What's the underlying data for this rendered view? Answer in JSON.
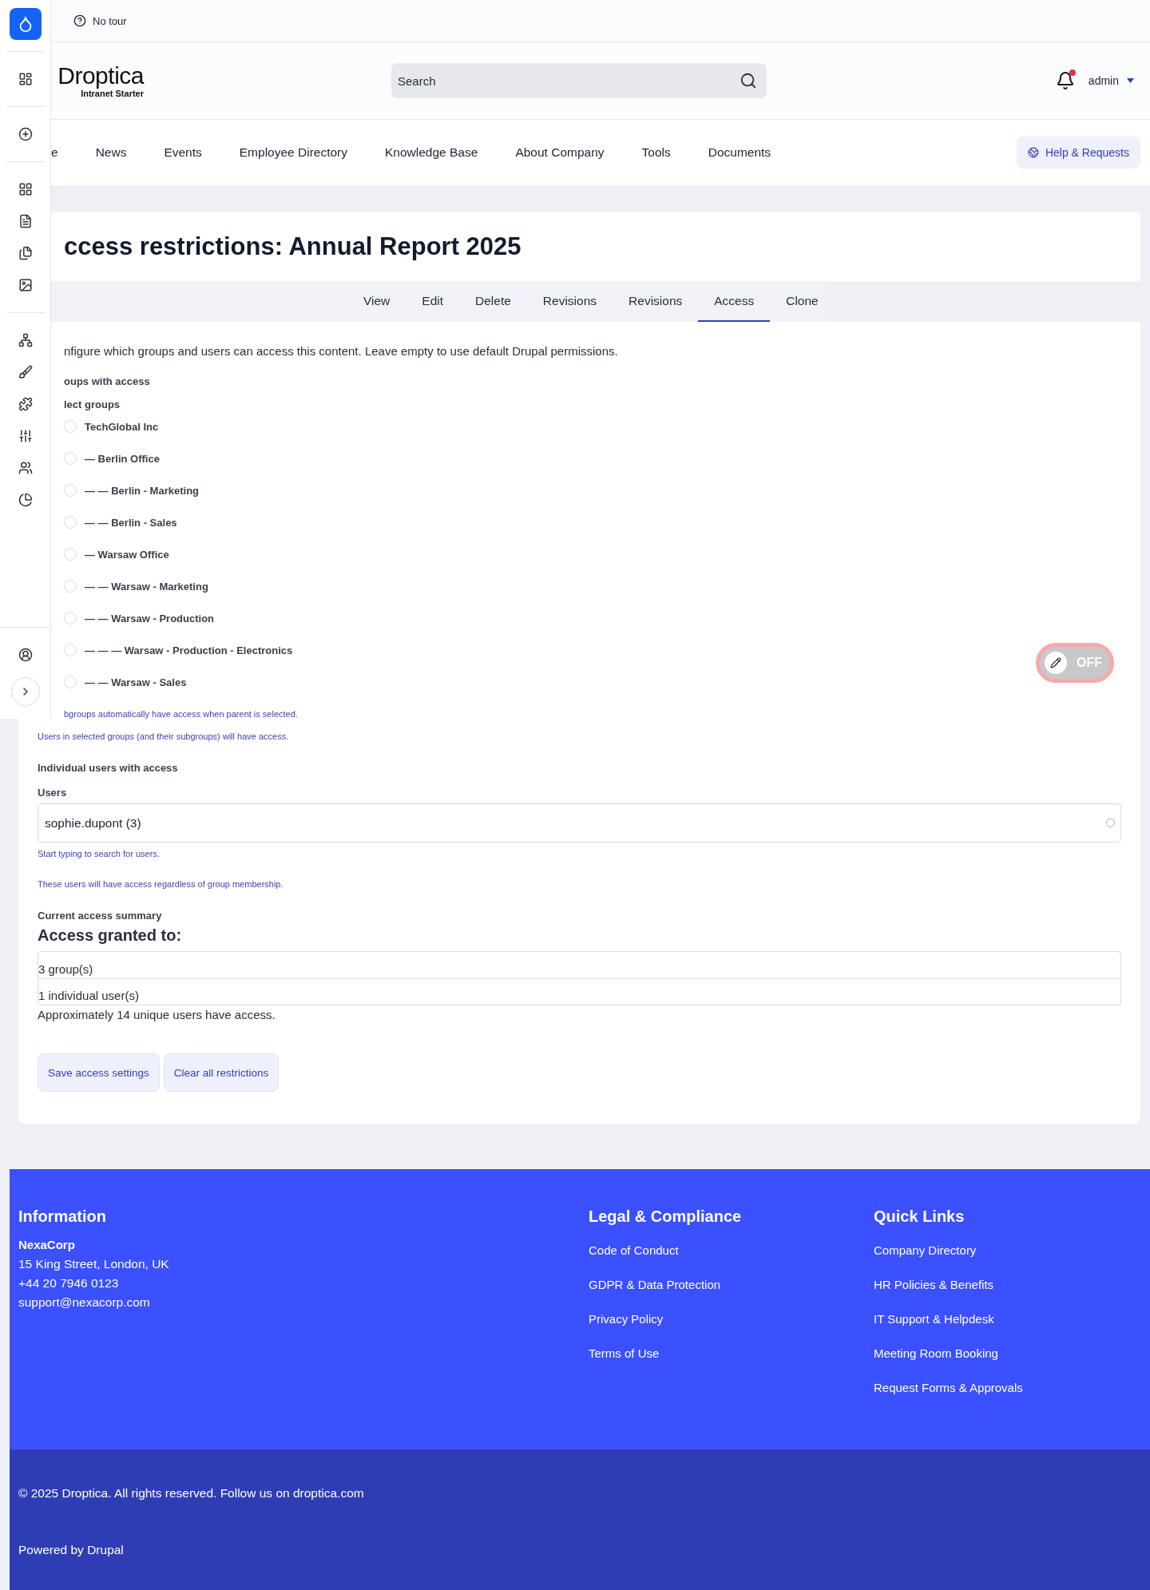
{
  "toolbar": {
    "tour": "No tour"
  },
  "header": {
    "logo": "Droptica",
    "logo_sub": "Intranet Starter",
    "search": {
      "placeholder": "Search"
    },
    "notifications": {
      "unread": true
    },
    "user": "admin"
  },
  "nav": {
    "items": [
      {
        "label": "e",
        "selected": false
      },
      {
        "label": "News",
        "selected": false
      },
      {
        "label": "Events",
        "selected": false
      },
      {
        "label": "Employee Directory",
        "selected": false
      },
      {
        "label": "Knowledge Base",
        "selected": false
      },
      {
        "label": "About Company",
        "selected": false
      },
      {
        "label": "Tools",
        "selected": false
      },
      {
        "label": "Documents",
        "selected": false
      }
    ],
    "help": "Help & Requests"
  },
  "page": {
    "title": "ccess restrictions: Annual Report 2025",
    "tabs": [
      {
        "label": "View",
        "selected": false
      },
      {
        "label": "Edit",
        "selected": false
      },
      {
        "label": "Delete",
        "selected": false
      },
      {
        "label": "Revisions",
        "selected": false
      },
      {
        "label": "Revisions",
        "selected": false
      },
      {
        "label": "Access",
        "selected": true
      },
      {
        "label": "Clone",
        "selected": false
      }
    ]
  },
  "form": {
    "intro": "nfigure which groups and users can access this content. Leave empty to use default Drupal permissions.",
    "groups_heading": "oups with access",
    "groups_label": "lect groups",
    "groups": [
      {
        "label": "TechGlobal Inc",
        "checked": false
      },
      {
        "label": "— Berlin Office",
        "checked": false
      },
      {
        "label": "— — Berlin - Marketing",
        "checked": false
      },
      {
        "label": "— — Berlin - Sales",
        "checked": false
      },
      {
        "label": "— Warsaw Office",
        "checked": false
      },
      {
        "label": "— — Warsaw - Marketing",
        "checked": false
      },
      {
        "label": "— — Warsaw - Production",
        "checked": false
      },
      {
        "label": "— — — Warsaw - Production - Electronics",
        "checked": false
      },
      {
        "label": "— — Warsaw - Sales",
        "checked": false
      }
    ],
    "groups_help": [
      "bgroups automatically have access when parent is selected.",
      "Users in selected groups (and their subgroups) will have access."
    ],
    "users_heading": "Individual users with access",
    "users_label": "Users",
    "users_value": "sophie.dupont (3)",
    "users_help": [
      "Start typing to search for users.",
      "These users will have access regardless of group membership."
    ],
    "summary_label": "Current access summary",
    "summary_title": "Access granted to:",
    "summary_rows": [
      "3 group(s)",
      "1 individual user(s)"
    ],
    "summary_note": "Approximately 14 unique users have access.",
    "buttons": [
      "Save access settings",
      "Clear all restrictions"
    ]
  },
  "edit_toggle": {
    "label": "OFF",
    "on": false
  },
  "footer": {
    "columns": [
      {
        "kind": "info",
        "title": "Information",
        "company": "NexaCorp",
        "lines": [
          "15 King Street, London, UK",
          "+44 20 7946 0123",
          "support@nexacorp.com"
        ]
      },
      {
        "kind": "links",
        "title": "Legal & Compliance",
        "links": [
          "Code of Conduct",
          "GDPR & Data Protection",
          "Privacy Policy",
          "Terms of Use"
        ]
      },
      {
        "kind": "links",
        "title": "Quick Links",
        "links": [
          "Company Directory",
          "HR Policies & Benefits",
          "IT Support & Helpdesk",
          "Meeting Room Booking",
          "Request Forms & Approvals"
        ]
      }
    ],
    "copyright": "© 2025 Droptica. All rights reserved. Follow us on droptica.com",
    "powered": "Powered by Drupal"
  }
}
